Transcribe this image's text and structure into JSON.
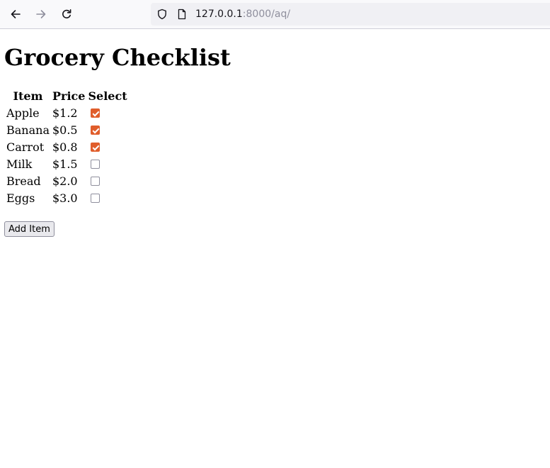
{
  "browser": {
    "url_host": "127.0.0.1",
    "url_rest": ":8000/aq/",
    "icons": {
      "back": "arrow-left-icon",
      "forward": "arrow-right-icon",
      "reload": "reload-icon",
      "shield": "shield-icon",
      "page": "page-icon"
    }
  },
  "page": {
    "title": "Grocery Checklist",
    "table": {
      "headers": [
        "Item",
        "Price",
        "Select"
      ],
      "rows": [
        {
          "item": "Apple",
          "price": "$1.2",
          "checked": true
        },
        {
          "item": "Banana",
          "price": "$0.5",
          "checked": true
        },
        {
          "item": "Carrot",
          "price": "$0.8",
          "checked": true
        },
        {
          "item": "Milk",
          "price": "$1.5",
          "checked": false
        },
        {
          "item": "Bread",
          "price": "$2.0",
          "checked": false
        },
        {
          "item": "Eggs",
          "price": "$3.0",
          "checked": false
        }
      ]
    },
    "add_button_label": "Add Item"
  },
  "colors": {
    "checkbox_accent": "#e05d2b",
    "toolbar_bg": "#f9f9fb",
    "urlbar_bg": "#f0f0f4"
  }
}
